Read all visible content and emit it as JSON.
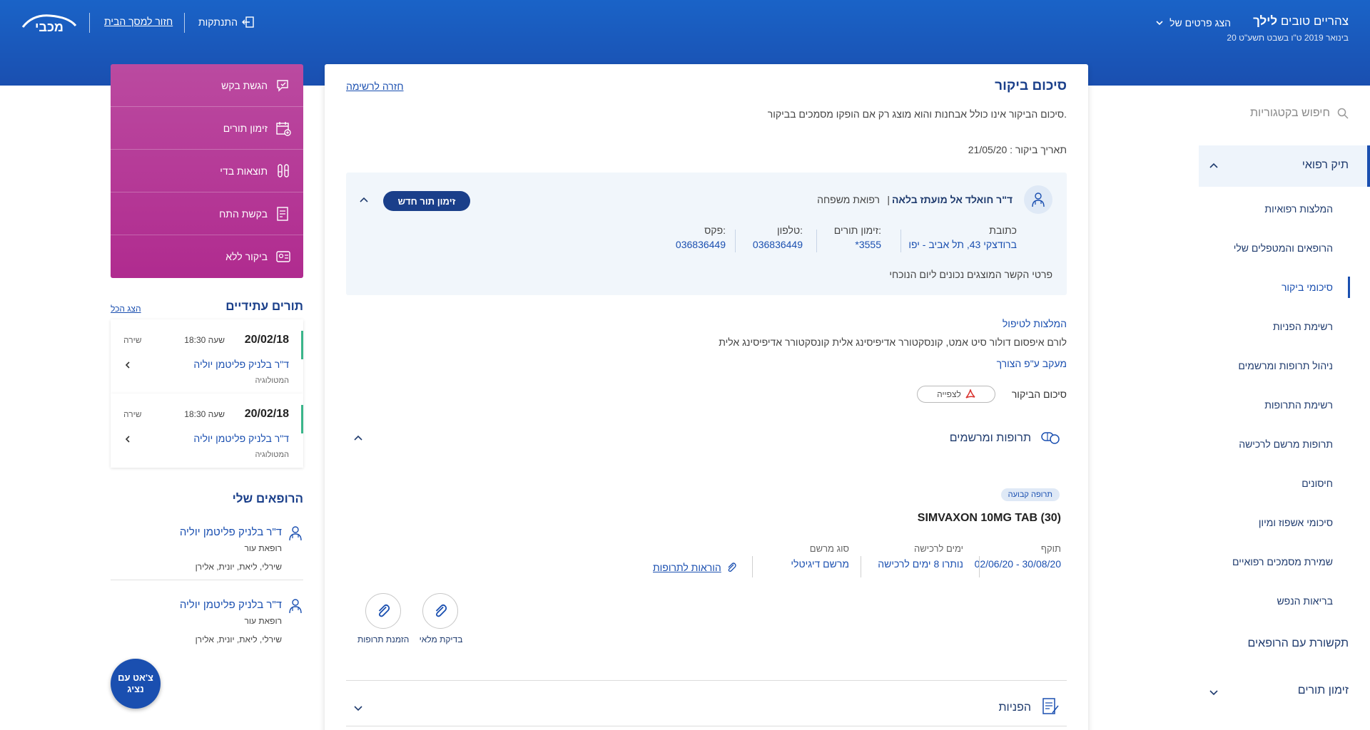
{
  "header": {
    "brand": "מכבי",
    "logout_label": "התנתקות",
    "home_label": "חזור למסך הבית",
    "greeting_prefix": "צהריים טובים",
    "greeting_name": "לילך",
    "date_line": "20 בינואר 2019 ט\"ו בשבט תשע\"ט",
    "show_details_label": "הצג פרטים של"
  },
  "right_nav": {
    "search_label": "חיפוש בקטגוריות",
    "medical_file": "תיק רפואי",
    "items": [
      "המלצות רפואיות",
      "הרופאים והמטפלים שלי",
      "סיכומי ביקור",
      "רשימת הפניות",
      "ניהול תרופות ומרשמים",
      "רשימת התרופות",
      "תרופות מרשם לרכישה",
      "חיסונים",
      "סיכומי אשפוז ומיון",
      "שמירת מסמכים רפואיים",
      "בריאות הנפש"
    ],
    "contact_doctors": "תקשורת עם הרופאים",
    "appointments": "זימון תורים"
  },
  "main": {
    "title": "סיכום ביקור",
    "back_label": "חזרה לרשימה",
    "note": "סיכום הביקור אינו כולל אבחנות והוא מוצג רק אם הופקו מסמכים בביקור.",
    "visit_date": "תאריך ביקור : 21/05/20",
    "doctor": {
      "name": "ד\"ר חואלד אל מועתז בלאה",
      "separator": "|",
      "specialty": "רפואת משפחה",
      "new_appt_label": "זימון תור חדש",
      "address_label": "כתובת",
      "address_value": "ברודצקי 43, תל אביב - יפו",
      "appt_label": "זימון תורים:",
      "appt_value": "*3555",
      "phone_label": "טלפון:",
      "phone_value": "036836449",
      "fax_label": "פקס:",
      "fax_value": "036836449",
      "footer": "פרטי הקשר המוצגים נכונים ליום הנוכחי"
    },
    "recommendations_title": "המלצות לטיפול",
    "recommendations_text": "לורם איפסום דולור סיט אמט, קונסקטורר אדיפיסינג אלית קונסקטורר אדיפיסינג אלית",
    "followup_label": "מעקב ע\"פ הצורך",
    "visit_summary_label": "סיכום הביקור",
    "view_label": "לצפייה",
    "meds_section": "תרופות ומרשמים",
    "med": {
      "badge": "תרופה קבועה",
      "name": "SIMVAXON 10MG TAB (30)",
      "validity_label": "תוקף",
      "validity_value": "02/06/20 - 30/08/20",
      "days_label": "ימים לרכישה",
      "days_value": "נותרו 8 ימים לרכישה",
      "type_label": "סוג מרשם",
      "type_value": "מרשם דיגיטלי",
      "instructions_label": "הוראות לתרופות"
    },
    "check_full_label": "בדיקת מלאי",
    "order_meds_label": "הזמנת תרופות",
    "referrals_section": "הפניות"
  },
  "actions": [
    "הגשת בקש",
    "זימון תורים",
    "תוצאות בדי",
    "בקשת התח",
    "ביקור ללא"
  ],
  "future": {
    "title": "תורים עתידיים",
    "show_all": "הצג הכל",
    "appointments": [
      {
        "date": "20/02/18",
        "time": "שעה 18:30",
        "loc": "שירה",
        "doctor": "ד\"ר בלניק פליטמן יוליה",
        "spec": "המטולוגיה"
      },
      {
        "date": "20/02/18",
        "time": "שעה 18:30",
        "loc": "שירה",
        "doctor": "ד\"ר בלניק פליטמן יוליה",
        "spec": "המטולוגיה"
      }
    ]
  },
  "my_doctors": {
    "title": "הרופאים שלי",
    "items": [
      {
        "name": "ד\"ר בלניק פליטמן יוליה",
        "spec": "רופאת עור",
        "locs": "שירלי, ליאת, יונית, אלירן"
      },
      {
        "name": "ד\"ר בלניק פליטמן יוליה",
        "spec": "רופאת עור",
        "locs": "שירלי, ליאת, יונית, אלירן"
      }
    ]
  },
  "chat": {
    "line1": "צ'אט עם",
    "line2": "נציג"
  }
}
